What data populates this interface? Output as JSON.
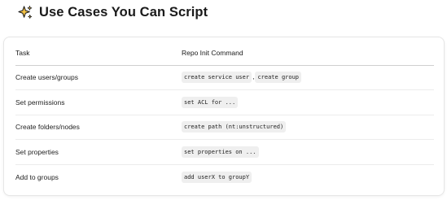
{
  "heading": {
    "icon": "sparkles-icon",
    "text": "Use Cases You Can Script"
  },
  "table": {
    "headers": [
      "Task",
      "Repo Init Command"
    ],
    "rows": [
      {
        "task": "Create users/groups",
        "commands": [
          "create service user",
          "create group"
        ],
        "separator": ","
      },
      {
        "task": "Set permissions",
        "commands": [
          "set ACL for ..."
        ]
      },
      {
        "task": "Create folders/nodes",
        "commands": [
          "create path (nt:unstructured)"
        ]
      },
      {
        "task": "Set properties",
        "commands": [
          "set properties on ..."
        ]
      },
      {
        "task": "Add to groups",
        "commands": [
          "add userX to groupY"
        ]
      }
    ]
  },
  "colors": {
    "code_background": "#efefef",
    "sparkle_fill": "#f6c445",
    "sparkle_stroke": "#1a1a1a"
  }
}
